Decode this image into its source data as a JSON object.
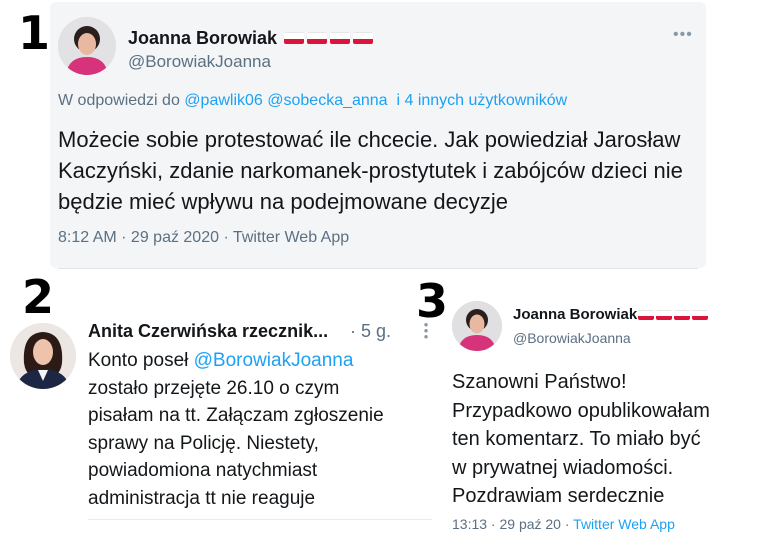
{
  "labels": {
    "one": "1",
    "two": "2",
    "three": "3"
  },
  "tweet1": {
    "name": "Joanna Borowiak",
    "handle": "@BorowiakJoanna",
    "more": "•••",
    "reply_prefix": "W odpowiedzi do",
    "reply_user1": "@pawlik06",
    "reply_user2": "@sobecka_anna",
    "reply_others": "i 4 innych użytkowników",
    "text": "Możecie sobie protestować ile chcecie. Jak powiedział Jarosław Kaczyński, zdanie narkomanek-prostytutek i zabójców dzieci nie będzie mieć wpływu na podejmowane decyzje",
    "meta": "8:12 AM · 29 paź 2020 · Twitter Web App",
    "flag_colors": [
      "#ffffff",
      "#dc143c"
    ]
  },
  "tweet2": {
    "name": "Anita Czerwińska rzecznik...",
    "time": "· 5 g.",
    "text_before": "Konto  poseł ",
    "mention": "@BorowiakJoanna",
    "text_after": "zostało przejęte 26.10 o czym\npisałam na tt. Załączam zgłoszenie\nsprawy na Policję. Niestety,\npowiadomiona natychmiast\nadministracja tt nie reaguje"
  },
  "tweet3": {
    "name": "Joanna Borowiak",
    "handle": "@BorowiakJoanna",
    "text": "Szanowni Państwo!\nPrzypadkowo opublikowałam\nten komentarz. To miało być\nw prywatnej wiadomości.\nPozdrawiam serdecznie",
    "time": "13:13 · 29 paź 20 · ",
    "app": "Twitter Web App"
  },
  "colors": {
    "link": "#1da1f2",
    "muted": "#5b7083",
    "panel_bg": "#f4f5f7"
  }
}
